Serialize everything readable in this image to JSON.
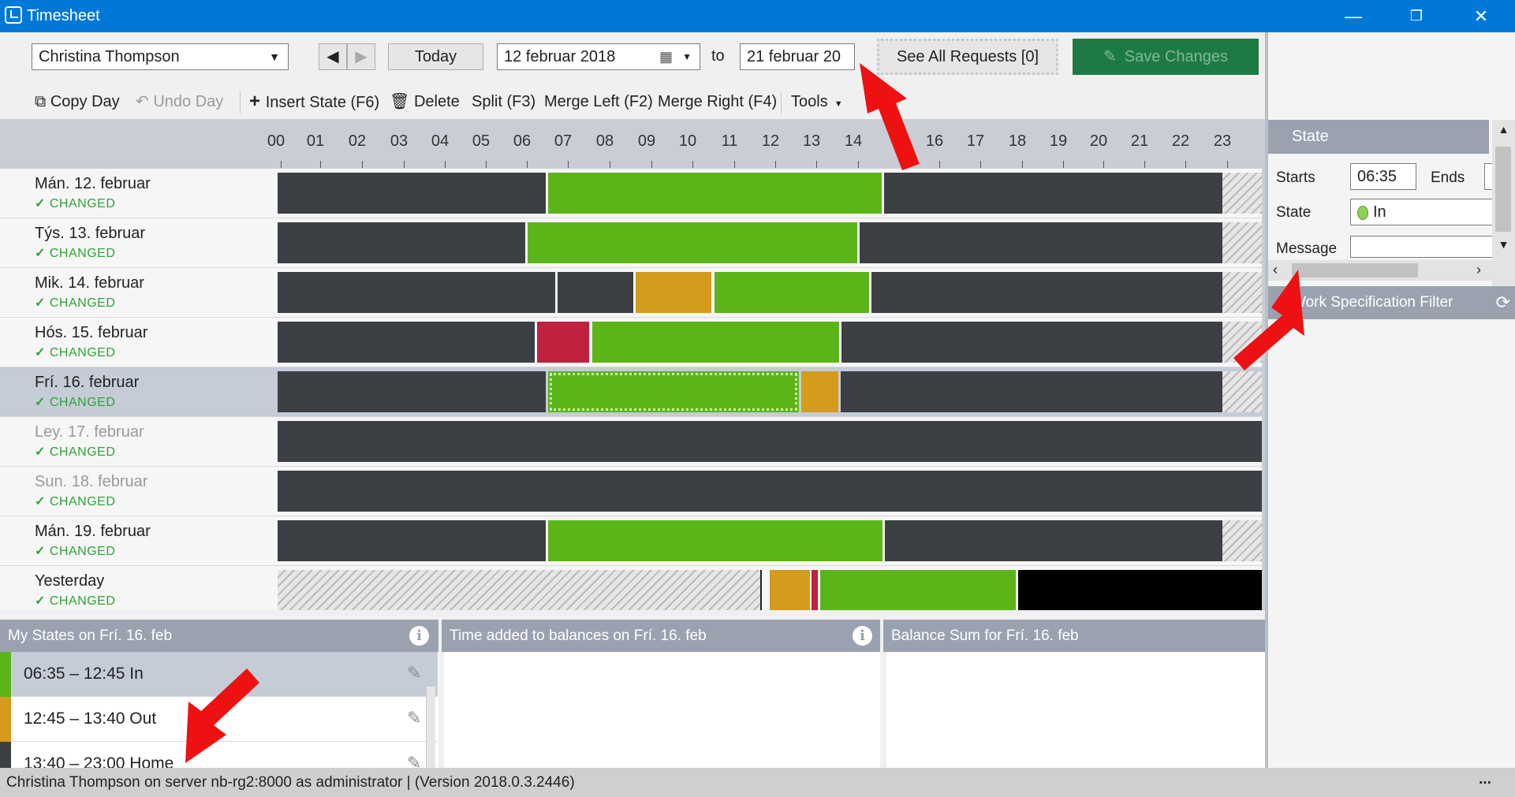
{
  "window": {
    "title": "Timesheet",
    "minimize": "—",
    "maximize": "❐",
    "close": "✕"
  },
  "toolbar": {
    "employee": "Christina Thompson",
    "today_label": "Today",
    "date_from": "12   februar   2018",
    "to_label": "to",
    "date_to": "21   februar   20",
    "see_requests": "See All Requests [0]",
    "save_changes": "Save Changes"
  },
  "actions": {
    "copy_day": "Copy Day",
    "undo_day": "Undo Day",
    "insert_state": "Insert State (F6)",
    "delete": "Delete",
    "split": "Split (F3)",
    "merge_left": "Merge Left (F2)",
    "merge_right": "Merge Right (F4)",
    "tools": "Tools"
  },
  "hours": [
    "00",
    "01",
    "02",
    "03",
    "04",
    "05",
    "06",
    "07",
    "08",
    "09",
    "10",
    "11",
    "12",
    "13",
    "14",
    "16",
    "17",
    "18",
    "19",
    "20",
    "21",
    "22",
    "23"
  ],
  "days": [
    {
      "label": "Mán. 12. februar",
      "status": "CHANGED"
    },
    {
      "label": "Týs. 13. februar",
      "status": "CHANGED"
    },
    {
      "label": "Mik. 14. februar",
      "status": "CHANGED"
    },
    {
      "label": "Hós. 15. februar",
      "status": "CHANGED"
    },
    {
      "label": "Frí. 16. februar",
      "status": "CHANGED"
    },
    {
      "label": "Ley. 17. februar",
      "status": "CHANGED"
    },
    {
      "label": "Sun. 18. februar",
      "status": "CHANGED"
    },
    {
      "label": "Mán. 19. februar",
      "status": "CHANGED"
    },
    {
      "label": "Yesterday",
      "status": "CHANGED"
    }
  ],
  "panels": {
    "my_states": "My States on Frí. 16. feb",
    "time_added": "Time added to balances on Frí. 16. feb",
    "balance_sum": "Balance Sum for Frí. 16. feb"
  },
  "states": [
    {
      "text": "06:35 – 12:45   In",
      "color": "#5cb518"
    },
    {
      "text": "12:45 – 13:40   Out",
      "color": "#d49b1c"
    },
    {
      "text": "13:40 – 23:00   Home",
      "color": "#3c3f44"
    }
  ],
  "side": {
    "header": "State",
    "starts_label": "Starts",
    "starts_value": "06:35",
    "ends_label": "Ends",
    "state_label": "State",
    "state_value": "In",
    "message_label": "Message",
    "filter_label": "Work Specification Filter"
  },
  "status": {
    "text": "Christina Thompson on server nb-rg2:8000 as administrator   |  (Version 2018.0.3.2446)",
    "more": "..."
  }
}
